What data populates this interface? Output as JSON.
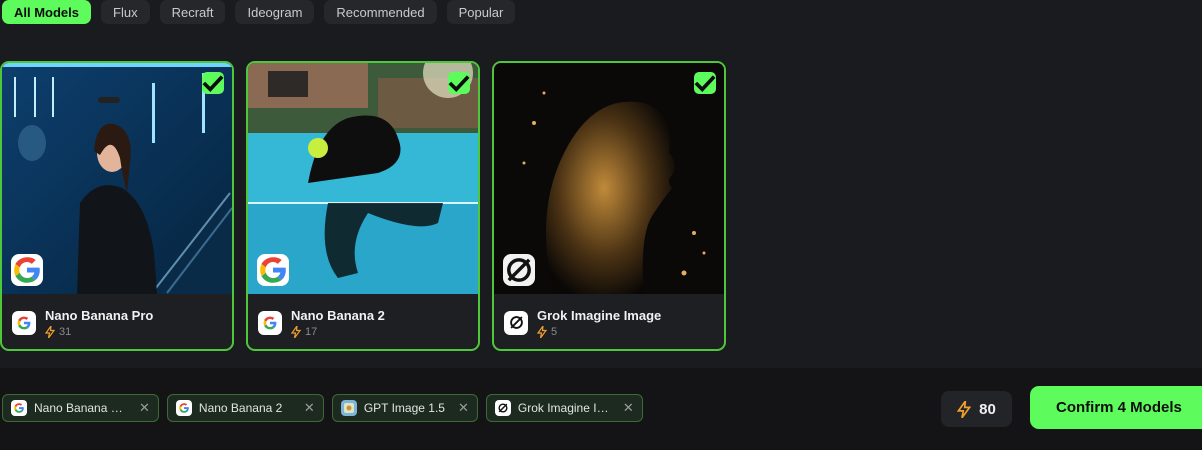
{
  "tabs": [
    {
      "label": "All Models",
      "active": true
    },
    {
      "label": "Flux"
    },
    {
      "label": "Recraft"
    },
    {
      "label": "Ideogram"
    },
    {
      "label": "Recommended"
    },
    {
      "label": "Popular"
    }
  ],
  "cards": [
    {
      "name": "Nano Banana Pro",
      "count": "31",
      "logo": "google-icon",
      "image": "woman-on-phone-in-blue-stairwell",
      "selected": true
    },
    {
      "name": "Nano Banana 2",
      "count": "17",
      "logo": "google-icon",
      "image": "black-dog-swimming-with-tennis-ball",
      "selected": true
    },
    {
      "name": "Grok Imagine Image",
      "count": "5",
      "logo": "grok-icon",
      "image": "golden-particle-face-profile",
      "selected": true
    }
  ],
  "chips": [
    {
      "label": "Nano Banana Pro",
      "logo": "google-icon"
    },
    {
      "label": "Nano Banana 2",
      "logo": "google-icon"
    },
    {
      "label": "GPT Image 1.5",
      "logo": "gpt-image-icon"
    },
    {
      "label": "Grok Imagine Image",
      "logo": "grok-icon"
    }
  ],
  "credits": {
    "value": "80",
    "icon": "lightning-icon"
  },
  "confirm_label": "Confirm 4 Models",
  "colors": {
    "accent": "#5dfc5c",
    "border": "#4fc73a",
    "bolt": "#f0a030",
    "background": "#1a1b1e"
  }
}
